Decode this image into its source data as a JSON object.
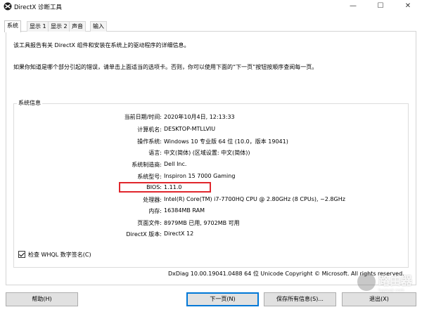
{
  "window": {
    "title": "DirectX 诊断工具",
    "minimize": "—",
    "maximize": "☐",
    "close": "✕"
  },
  "tabs": [
    {
      "label": "系统",
      "active": true
    },
    {
      "label": "显示 1"
    },
    {
      "label": "显示 2"
    },
    {
      "label": "声音"
    },
    {
      "label": "输入"
    }
  ],
  "intro": {
    "line1": "该工具报告有关 DirectX 组件和安装在系统上的驱动程序的详细信息。",
    "line2": "如果你知道是哪个部分引起的错误，请单击上面适当的选项卡。否则，你可以使用下面的“下一页”按钮按顺序查阅每一页。"
  },
  "system_info": {
    "group_label": "系统信息",
    "rows": [
      {
        "label": "当前日期/时间:",
        "value": "2020年10月4日, 12:13:33"
      },
      {
        "label": "计算机名:",
        "value": "DESKTOP-MTLLVIU"
      },
      {
        "label": "操作系统:",
        "value": "Windows 10 专业版 64 位 (10.0，版本 19041)"
      },
      {
        "label": "语言:",
        "value": "中文(简体) (区域设置: 中文(简体))"
      },
      {
        "label": "系统制造商:",
        "value": "Dell Inc."
      },
      {
        "label": "系统型号:",
        "value": "Inspiron 15 7000 Gaming"
      },
      {
        "label": "BIOS:",
        "value": "1.11.0"
      },
      {
        "label": "处理器:",
        "value": "Intel(R) Core(TM) i7-7700HQ CPU @ 2.80GHz (8 CPUs), ~2.8GHz"
      },
      {
        "label": "内存:",
        "value": "16384MB RAM"
      },
      {
        "label": "页面文件:",
        "value": "8979MB 已用, 9702MB 可用"
      },
      {
        "label": "DirectX 版本:",
        "value": "DirectX 12"
      }
    ]
  },
  "whql_check": {
    "label": "检查 WHQL 数字签名(C)",
    "checked": true
  },
  "footer": {
    "version_text": "DxDiag 10.00.19041.0488 64 位 Unicode  Copyright © Microsoft. All rights reserved."
  },
  "watermark": {
    "text": "路由器",
    "sub": "luyouqi.com"
  },
  "buttons": {
    "help": "帮助(H)",
    "next": "下一页(N)",
    "save": "保存所有信息(S)...",
    "exit": "退出(X)"
  },
  "colors": {
    "highlight_box": "#e0262c",
    "default_button_border": "#0078d7"
  }
}
